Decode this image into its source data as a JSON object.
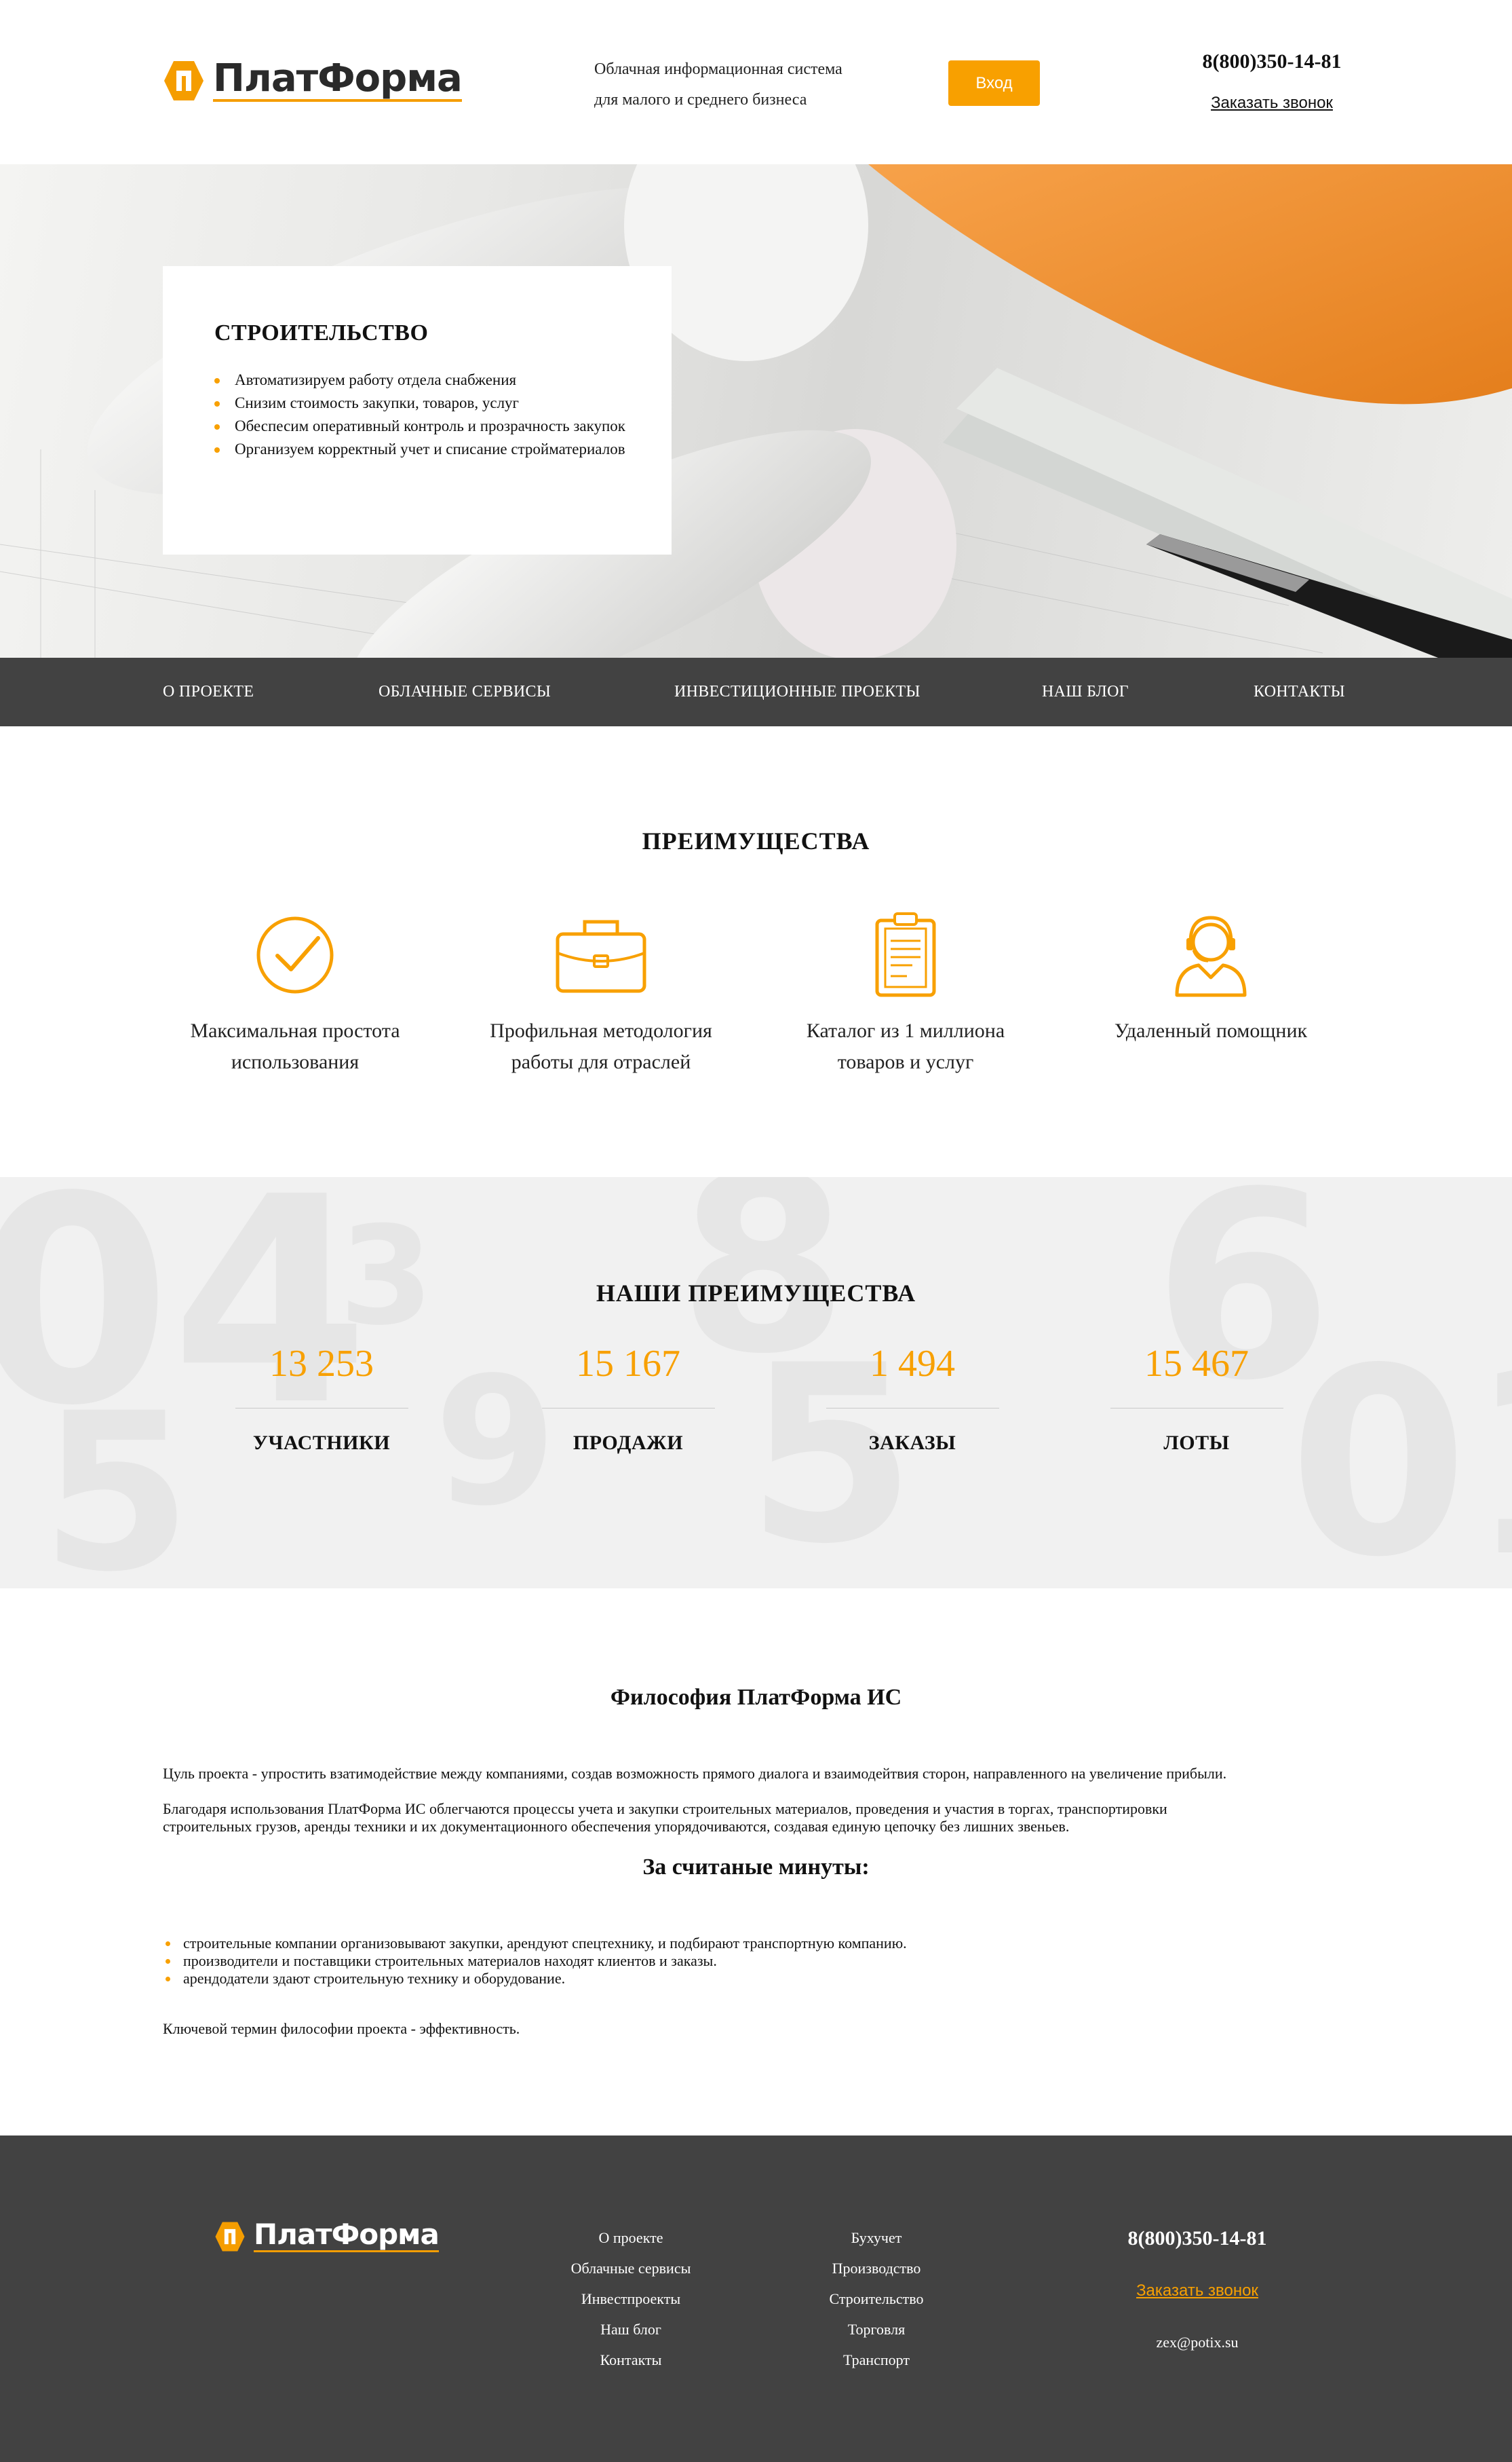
{
  "header": {
    "logo_text": "ПлатФорма",
    "tagline_line1": "Облачная информационная система",
    "tagline_line2": "для малого и среднего бизнеса",
    "login_label": "Вход",
    "phone": "8(800)350-14-81",
    "callback_label": "Заказать звонок"
  },
  "hero": {
    "title": "СТРОИТЕЛЬСТВО",
    "items": [
      "Автоматизируем работу отдела снабжения",
      "Снизим стоимость закупки, товаров, услуг",
      "Обеспесим оперативный контроль и прозрачность закупок",
      "Организуем корректный учет и списание стройматериалов"
    ]
  },
  "nav": {
    "items": [
      "О ПРОЕКТЕ",
      "ОБЛАЧНЫЕ СЕРВИСЫ",
      "ИНВЕСТИЦИОННЫЕ ПРОЕКТЫ",
      "НАШ БЛОГ",
      "КОНТАКТЫ"
    ]
  },
  "advantages": {
    "title": "ПРЕИМУЩЕСТВА",
    "items": [
      {
        "icon": "checkmark-circle-icon",
        "line1": "Максимальная простота",
        "line2": "использования"
      },
      {
        "icon": "briefcase-icon",
        "line1": "Профильная методология",
        "line2": "работы для отраслей"
      },
      {
        "icon": "document-clipboard-icon",
        "line1": "Каталог из 1 миллиона",
        "line2": "товаров и услуг"
      },
      {
        "icon": "support-agent-icon",
        "line1": "Удаленный помощник",
        "line2": ""
      }
    ]
  },
  "stats": {
    "title": "НАШИ ПРЕИМУЩЕСТВА",
    "items": [
      {
        "value": "13 253",
        "label": "УЧАСТНИКИ"
      },
      {
        "value": "15 167",
        "label": "ПРОДАЖИ"
      },
      {
        "value": "1 494",
        "label": "ЗАКАЗЫ"
      },
      {
        "value": "15 467",
        "label": "ЛОТЫ"
      }
    ]
  },
  "philosophy": {
    "title": "Философия ПлатФорма ИС",
    "goal": "Цуль проекта - упростить взатимодействие между компаниями, создав возможность прямого диалога и взаимодейтвия сторон, направленного на увеличение прибыли.",
    "usage_line1": "Благодаря использования ПлатФорма ИС облегчаются процессы учета и закупки строительных материалов, проведения и участия в торгах, транспортировки",
    "usage_line2": "строительных грузов, аренды техники и их документационного обеспечения упорядочиваются, создавая единую цепочку без лишних звеньев.",
    "minutes_title": "За считаные минуты:",
    "minutes_items": [
      "строительные компании организовывают закупки, арендуют спецтехнику, и подбирают транспортную компанию.",
      "производители и поставщики строительных материалов находят клиентов и заказы.",
      "арендодатели здают строительную технику и оборудование."
    ],
    "key_term": "Ключевой термин философии проекта - эффективность."
  },
  "footer": {
    "logo_text": "ПлатФорма",
    "col1": [
      "О проекте",
      "Облачные сервисы",
      "Инвестпроекты",
      "Наш блог",
      "Контакты"
    ],
    "col2": [
      "Бухучет",
      "Производство",
      "Строительство",
      "Торговля",
      "Транспорт"
    ],
    "phone": "8(800)350-14-81",
    "callback_label": "Заказать звонок",
    "email": "zex@potix.su"
  },
  "colors": {
    "accent": "#f8a000",
    "dark": "#424242"
  }
}
